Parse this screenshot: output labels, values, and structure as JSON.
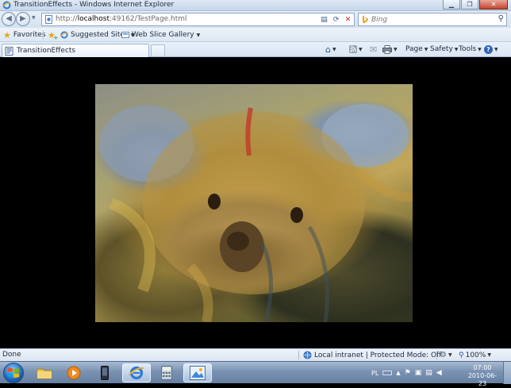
{
  "window": {
    "title": "TransitionEffects - Windows Internet Explorer",
    "minimize_icon": "minimize-icon",
    "maximize_icon": "restore-icon",
    "close_icon": "close-icon"
  },
  "address_bar": {
    "url_prefix": "http://",
    "url_host": "localhost",
    "url_rest": ":49162/TestPage.html",
    "search_placeholder": "Bing"
  },
  "favorites_bar": {
    "favorites_label": "Favorites",
    "items": [
      {
        "label": "Suggested Sites",
        "icon": "ie-icon"
      },
      {
        "label": "Web Slice Gallery",
        "icon": "web-slice-icon"
      }
    ]
  },
  "tabs": [
    {
      "label": "TransitionEffects",
      "icon": "silverlight-page-icon",
      "active": true
    }
  ],
  "command_bar": {
    "page_label": "Page",
    "safety_label": "Safety",
    "tools_label": "Tools",
    "help_icon": "help-icon"
  },
  "content": {
    "image_subject": "koala-transition-image"
  },
  "status_bar": {
    "status_text": "Done",
    "zone_text": "Local intranet | Protected Mode: Off",
    "zoom": "100%"
  },
  "taskbar": {
    "language": "PL",
    "time": "07:00",
    "date": "2010-06-23",
    "buttons": [
      {
        "name": "explorer",
        "icon": "folder-icon"
      },
      {
        "name": "media-player",
        "icon": "media-player-icon"
      },
      {
        "name": "phone",
        "icon": "phone-icon"
      },
      {
        "name": "internet-explorer",
        "icon": "ie-icon",
        "active": true
      },
      {
        "name": "calculator",
        "icon": "calculator-icon"
      },
      {
        "name": "paint",
        "icon": "picture-icon",
        "active": true
      }
    ]
  }
}
